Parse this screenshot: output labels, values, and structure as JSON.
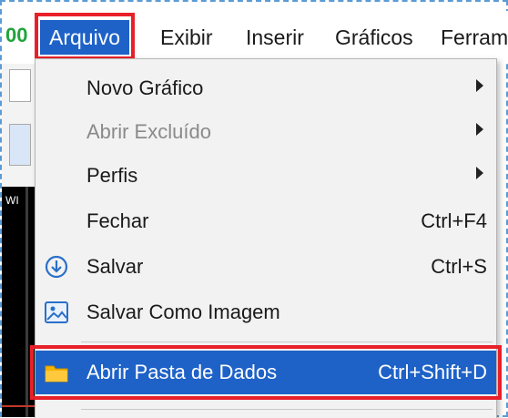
{
  "menubar": {
    "items": [
      {
        "label": "Arquivo",
        "active": true
      },
      {
        "label": "Exibir"
      },
      {
        "label": "Inserir"
      },
      {
        "label": "Gráficos"
      },
      {
        "label": "Ferrame"
      }
    ]
  },
  "behind": {
    "chart_label": "WI"
  },
  "dropdown": {
    "items": [
      {
        "label": "Novo Gráfico",
        "shortcut": "",
        "submenu": true,
        "icon": ""
      },
      {
        "label": "Abrir Excluído",
        "shortcut": "",
        "submenu": true,
        "disabled": true,
        "icon": ""
      },
      {
        "label": "Perfis",
        "shortcut": "",
        "submenu": true,
        "icon": ""
      },
      {
        "label": "Fechar",
        "shortcut": "Ctrl+F4",
        "icon": ""
      },
      {
        "label": "Salvar",
        "shortcut": "Ctrl+S",
        "icon": "save-icon"
      },
      {
        "label": "Salvar Como Imagem",
        "shortcut": "",
        "icon": "image-icon"
      },
      {
        "label": "Abrir Pasta de Dados",
        "shortcut": "Ctrl+Shift+D",
        "icon": "folder-icon",
        "highlighted": true
      }
    ]
  },
  "colors": {
    "accent": "#1e62c8",
    "highlight_border": "#e8202a"
  }
}
